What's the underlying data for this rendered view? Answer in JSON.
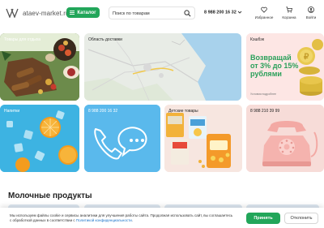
{
  "header": {
    "logo_text": "ataev-market.ru",
    "catalog_label": "Каталог",
    "search_placeholder": "Поиск по товарам",
    "phone": "8 988 200 16 32",
    "icons": [
      {
        "name": "favorites",
        "label": "Избранное"
      },
      {
        "name": "cart",
        "label": "Корзина"
      },
      {
        "name": "login",
        "label": "Войти"
      }
    ]
  },
  "cards": {
    "products": {
      "title": "Товары для отдыха"
    },
    "map": {
      "title": "Область доставки"
    },
    "cashback": {
      "title": "Кэшбэк",
      "headline_1": "Возвращай",
      "headline_2": "от 3% до 15%",
      "headline_3": "рублями",
      "note": "Условия подробнее"
    },
    "drinks": {
      "title": "Напитки"
    },
    "phone1": {
      "title": "8 988 200 16 32"
    },
    "kids": {
      "title": "Детские товары"
    },
    "phone2": {
      "title": "8 988 210 39 99"
    }
  },
  "section_title": "Молочные продукты",
  "cookie": {
    "text_1": "Мы используем файлы cookie и сервисы аналитики для улучшения работы сайта. Продолжая использовать сайт, вы соглашаетесь",
    "text_2": "с обработкой данных в соответствии с",
    "link": "Политикой конфиденциальности",
    "accept": "Принять",
    "decline": "Отклонить"
  },
  "colors": {
    "accent": "#22a65a",
    "link": "#1a73c9"
  }
}
